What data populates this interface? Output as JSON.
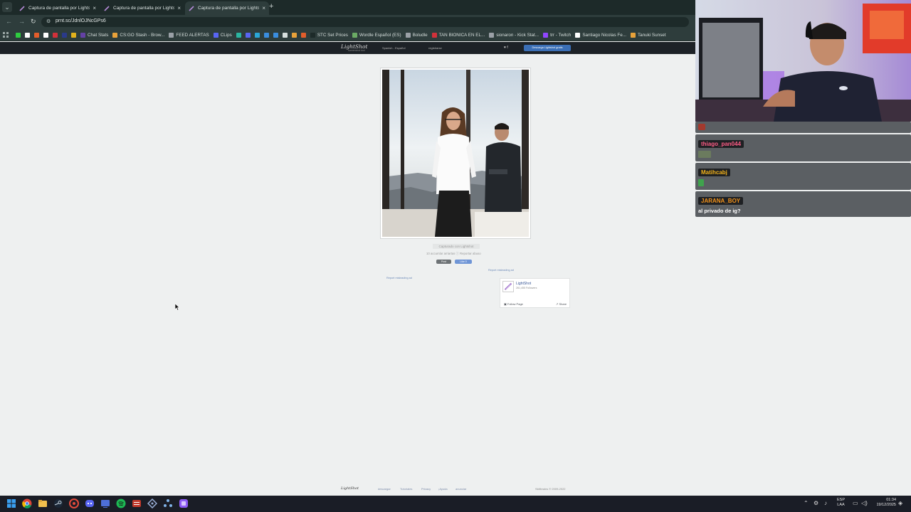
{
  "browser": {
    "tabs": [
      {
        "title": "Captura de pantalla por Lightshot",
        "active": false
      },
      {
        "title": "Captura de pantalla por Lightshot",
        "active": false
      },
      {
        "title": "Captura de pantalla por Lightshot",
        "active": true
      }
    ],
    "new_tab": "+",
    "tab_close": "×",
    "url": "prnt.sc/JdnlOJNcGPs6",
    "bookmarks": [
      {
        "label": "",
        "icon_color": "#2ecc40"
      },
      {
        "label": "",
        "icon_color": "#ffffff"
      },
      {
        "label": "",
        "icon_color": "#e25d2b"
      },
      {
        "label": "",
        "icon_color": "#ffffff"
      },
      {
        "label": "",
        "icon_color": "#d1313a"
      },
      {
        "label": "",
        "icon_color": "#2a3a8a"
      },
      {
        "label": "",
        "icon_color": "#e2b21c"
      },
      {
        "label": "Chat Stats",
        "icon_color": "#6441a5"
      },
      {
        "label": "CS:GO Stash - Brow...",
        "icon_color": "#e8a23a"
      },
      {
        "label": "FEED ALERTAS",
        "icon_color": "#9aa0a6"
      },
      {
        "label": "CLips",
        "icon_color": "#5865f2"
      },
      {
        "label": "",
        "icon_color": "#2bb5a0"
      },
      {
        "label": "",
        "icon_color": "#5865f2"
      },
      {
        "label": "",
        "icon_color": "#2aa7d6"
      },
      {
        "label": "",
        "icon_color": "#3a8dde"
      },
      {
        "label": "",
        "icon_color": "#3a8dde"
      },
      {
        "label": "",
        "icon_color": "#d7dfdd"
      },
      {
        "label": "",
        "icon_color": "#e8a23a"
      },
      {
        "label": "",
        "icon_color": "#e25d2b"
      },
      {
        "label": "STC Set Prices",
        "icon_color": "#1d2a29"
      },
      {
        "label": "Wordle Español (ES)",
        "icon_color": "#6aaa64"
      },
      {
        "label": "Boludle",
        "icon_color": "#9aa0a6"
      },
      {
        "label": "TAN BIONICA EN EL...",
        "icon_color": "#d1313a"
      },
      {
        "label": "sionaron - Kick Stat...",
        "icon_color": "#9aa0a6"
      },
      {
        "label": "trr - Twitch",
        "icon_color": "#9146ff"
      },
      {
        "label": "Santiago Nicolas Fe...",
        "icon_color": "#ffffff"
      },
      {
        "label": "Tanuki Sunset",
        "icon_color": "#e8a23a"
      }
    ]
  },
  "lightshot": {
    "logo": "LightShot",
    "logo_sub": "screenshot tool",
    "lang": "Spanish - Español",
    "nav2": "registrarse",
    "social": "♥  f",
    "download_button": "Descarga Lightshot gratis",
    "caption": "Capturado con Lightshot",
    "meta": "10 accumlar arriartas   ⓘ Reportar abuso",
    "tweet": "Post",
    "like": "Like 0",
    "report_a": "Report misleading ad",
    "report_b": "Report misleading ad",
    "fb": {
      "name": "LightShot",
      "followers": "261,455 Followers",
      "follow": "Follow Page",
      "share": "Share"
    },
    "footer": {
      "logo": "LightShot",
      "links": [
        "descargar",
        "Tutoriales",
        "Privacy",
        "¡Ayuda",
        "anunciar"
      ],
      "copyright": "Skillbrains © 2009-2022"
    }
  },
  "chat": {
    "messages": [
      {
        "user": "thiago_pan044",
        "user_color": "#ff5d87",
        "text": "",
        "emote_color": "#6b7b5e"
      },
      {
        "user": "Matihcabj",
        "user_color": "#f2b21b",
        "text": "",
        "emote_color": "#3fa34d"
      },
      {
        "user": "JARANA_BOY",
        "user_color": "#f2921b",
        "text": "al privado de ig?",
        "emote_color": ""
      }
    ]
  },
  "taskbar": {
    "lang_top": "ESP",
    "lang_bottom": "LAA",
    "time": "01:34",
    "date": "19/12/2025"
  }
}
